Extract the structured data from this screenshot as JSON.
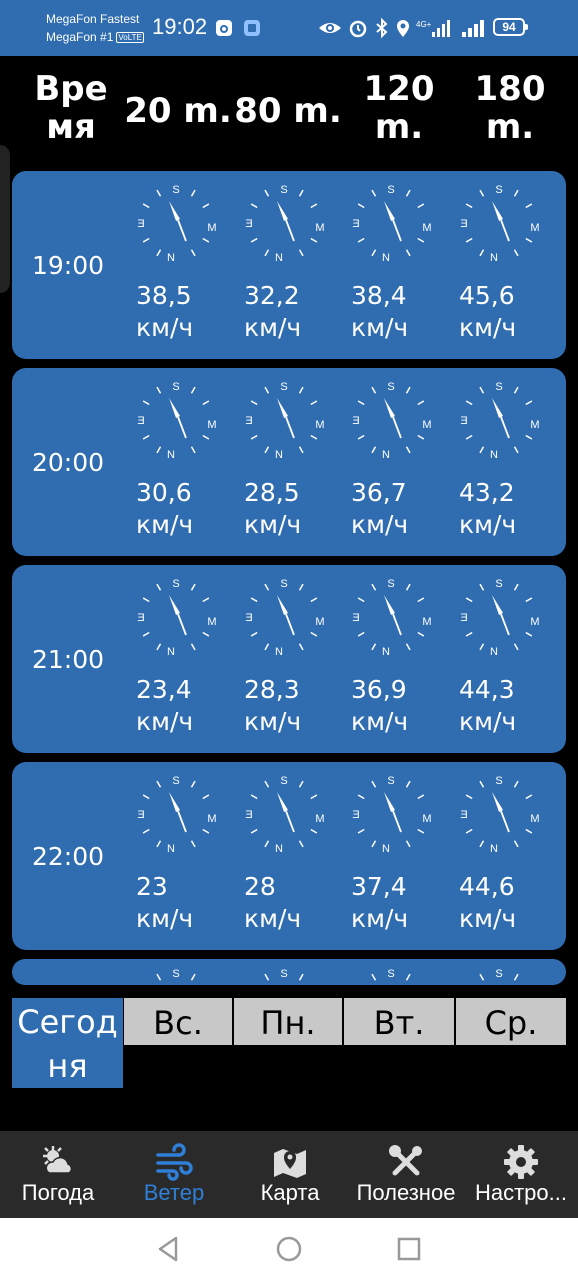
{
  "status": {
    "carrier1": "MegaFon Fastest",
    "carrier2": "MegaFon #1",
    "volte": "VoLTE",
    "time": "19:02",
    "battery": "94",
    "network": "4G+"
  },
  "header": {
    "time_label": "Вре\nмя",
    "columns": [
      "20 m.",
      "80 m.",
      "120\nm.",
      "180\nm."
    ]
  },
  "compass": {
    "n": "N",
    "s": "S",
    "e": "Ǝ",
    "w": "M"
  },
  "rows": [
    {
      "time": "19:00",
      "speeds": [
        "38,5",
        "32,2",
        "38,4",
        "45,6"
      ],
      "unit": "км/ч"
    },
    {
      "time": "20:00",
      "speeds": [
        "30,6",
        "28,5",
        "36,7",
        "43,2"
      ],
      "unit": "км/ч"
    },
    {
      "time": "21:00",
      "speeds": [
        "23,4",
        "28,3",
        "36,9",
        "44,3"
      ],
      "unit": "км/ч"
    },
    {
      "time": "22:00",
      "speeds": [
        "23",
        "28",
        "37,4",
        "44,6"
      ],
      "unit": "км/ч"
    }
  ],
  "days": [
    {
      "label": "Сегод\nня",
      "active": true
    },
    {
      "label": "Вс.",
      "active": false
    },
    {
      "label": "Пн.",
      "active": false
    },
    {
      "label": "Вт.",
      "active": false
    },
    {
      "label": "Ср.",
      "active": false
    }
  ],
  "nav": [
    {
      "label": "Погода",
      "icon": "weather-icon"
    },
    {
      "label": "Ветер",
      "icon": "wind-icon",
      "active": true
    },
    {
      "label": "Карта",
      "icon": "map-icon"
    },
    {
      "label": "Полезное",
      "icon": "tools-icon"
    },
    {
      "label": "Настро...",
      "icon": "settings-icon"
    }
  ],
  "colors": {
    "accent": "#2f6cb0",
    "active_nav": "#2f7fd8",
    "tab_inactive": "#c8c8c8"
  }
}
